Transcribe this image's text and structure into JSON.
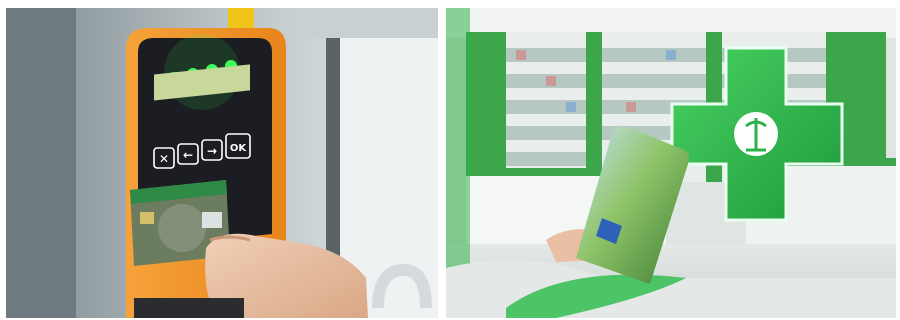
{
  "photos": {
    "left": {
      "subject": "bus-card-validator",
      "buttons": [
        {
          "glyph": "✕",
          "name": "cancel"
        },
        {
          "glyph": "←",
          "name": "back"
        },
        {
          "glyph": "→",
          "name": "forward"
        },
        {
          "glyph": "OK",
          "name": "ok"
        }
      ],
      "indicator_count": 4,
      "colors": {
        "body": "#f39a2b",
        "panel": "#1b1d22",
        "led": "#3cff5a",
        "card": "#6b7d5e"
      }
    },
    "right": {
      "subject": "pharmacy-interior",
      "colors": {
        "cross": "#2bb34a",
        "shelves": "#3da54b",
        "floor": "#d6dcd9"
      }
    }
  }
}
